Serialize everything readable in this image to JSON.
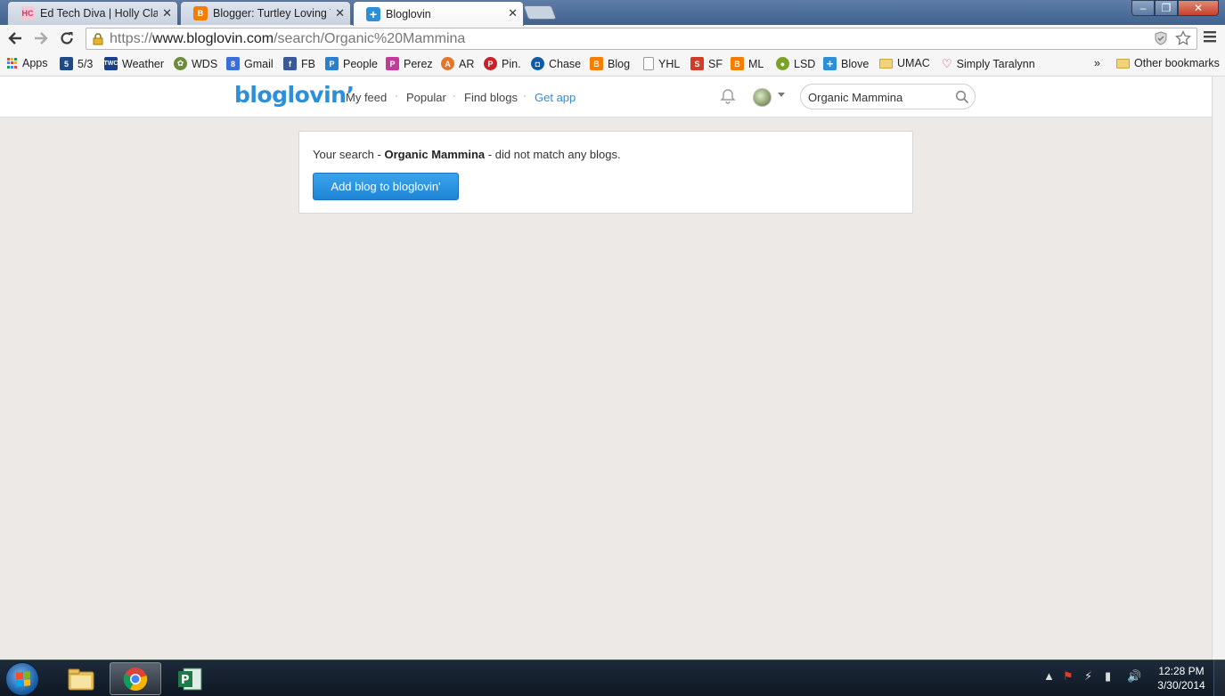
{
  "tabs": [
    {
      "title": "Ed Tech Diva | Holly Clark",
      "favicon_text": "HC",
      "favicon_color": "#f3c9d6",
      "favicon_fg": "#c23a6b",
      "active": false
    },
    {
      "title": "Blogger: Turtley Loving Te",
      "favicon_text": "B",
      "favicon_color": "#f57d00",
      "favicon_fg": "#ffffff",
      "active": false
    },
    {
      "title": "Bloglovin",
      "favicon_text": "+",
      "favicon_color": "#2c8fd8",
      "favicon_fg": "#ffffff",
      "active": true
    }
  ],
  "window_controls": {
    "minimize": "‒",
    "maximize": "❐",
    "close": "✕"
  },
  "toolbar": {
    "url_scheme": "https://",
    "url_host": "www.bloglovin.com",
    "url_path": "/search/Organic%20Mammina"
  },
  "bookmarks": [
    {
      "label": "Apps",
      "icon": "apps-grid-icon",
      "color": "#e1483a"
    },
    {
      "label": "5/3",
      "icon": "fifth-third-icon",
      "color": "#1f4a8a"
    },
    {
      "label": "Weather",
      "icon": "twc-icon",
      "color": "#1a3f8f"
    },
    {
      "label": "WDS",
      "icon": "wds-icon",
      "color": "#6d8c3a"
    },
    {
      "label": "Gmail",
      "icon": "gmail-icon",
      "color": "#3b6fd8"
    },
    {
      "label": "FB",
      "icon": "facebook-icon",
      "color": "#3b5998"
    },
    {
      "label": "People",
      "icon": "people-icon",
      "color": "#2a7fd0"
    },
    {
      "label": "Perez",
      "icon": "perez-icon",
      "color": "#c23a9b"
    },
    {
      "label": "AR",
      "icon": "ar-icon",
      "color": "#e8742a"
    },
    {
      "label": "Pin.",
      "icon": "pinterest-icon",
      "color": "#cb2027"
    },
    {
      "label": "Chase",
      "icon": "chase-icon",
      "color": "#0f5aa8"
    },
    {
      "label": "Blog",
      "icon": "blogger-icon",
      "color": "#f57d00"
    },
    {
      "label": "YHL",
      "icon": "page-icon",
      "color": "#ffffff"
    },
    {
      "label": "SF",
      "icon": "sf-icon",
      "color": "#d23a2a"
    },
    {
      "label": "ML",
      "icon": "blogger-icon",
      "color": "#f57d00"
    },
    {
      "label": "LSD",
      "icon": "lsd-icon",
      "color": "#7aa22a"
    },
    {
      "label": "Blove",
      "icon": "bloglovin-icon",
      "color": "#2c8fd8"
    },
    {
      "label": "UMAC",
      "icon": "folder-icon",
      "color": "#f2d27a"
    },
    {
      "label": "Simply Taralynn",
      "icon": "heart-icon",
      "color": "#c2344e"
    }
  ],
  "bookmarks_overflow": "»",
  "other_bookmarks": "Other bookmarks",
  "site": {
    "logo": "bloglovin’",
    "nav": [
      "My feed",
      "Popular",
      "Find blogs",
      "Get app"
    ],
    "search_value": "Organic Mammina",
    "accent_color": "#2c8fd8"
  },
  "result": {
    "prefix": "Your search - ",
    "query": "Organic Mammina",
    "suffix": " - did not match any blogs.",
    "button": "Add blog to bloglovin'"
  },
  "taskbar": {
    "apps": [
      {
        "name": "file-explorer",
        "active": false
      },
      {
        "name": "chrome",
        "active": true
      },
      {
        "name": "publisher",
        "active": false
      }
    ],
    "time": "12:28 PM",
    "date": "3/30/2014"
  }
}
